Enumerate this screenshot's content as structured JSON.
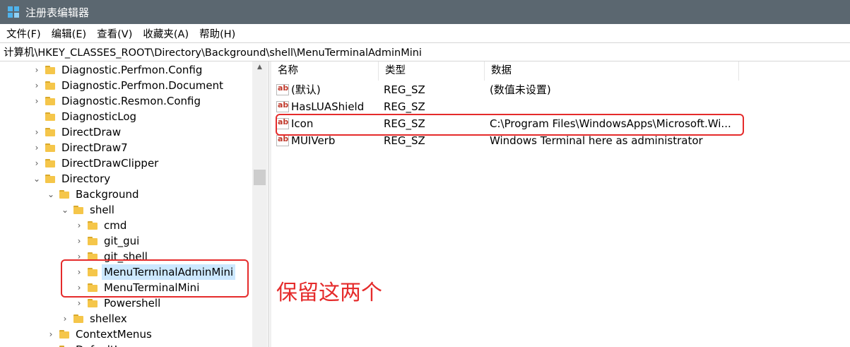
{
  "window": {
    "title": "注册表编辑器",
    "icon": "registry-icon"
  },
  "menubar": {
    "items": [
      "文件(F)",
      "编辑(E)",
      "查看(V)",
      "收藏夹(A)",
      "帮助(H)"
    ]
  },
  "address": {
    "path": "计算机\\HKEY_CLASSES_ROOT\\Directory\\Background\\shell\\MenuTerminalAdminMini"
  },
  "tree": {
    "items": [
      {
        "label": "Diagnostic.Perfmon.Config",
        "expander": "›"
      },
      {
        "label": "Diagnostic.Perfmon.Document",
        "expander": "›"
      },
      {
        "label": "Diagnostic.Resmon.Config",
        "expander": "›"
      },
      {
        "label": "DiagnosticLog",
        "expander": ""
      },
      {
        "label": "DirectDraw",
        "expander": "›"
      },
      {
        "label": "DirectDraw7",
        "expander": "›"
      },
      {
        "label": "DirectDrawClipper",
        "expander": "›"
      },
      {
        "label": "Directory",
        "expander": "⌄"
      },
      {
        "label": "Background",
        "expander": "⌄"
      },
      {
        "label": "shell",
        "expander": "⌄"
      },
      {
        "label": "cmd",
        "expander": "›"
      },
      {
        "label": "git_gui",
        "expander": "›"
      },
      {
        "label": "git_shell",
        "expander": "›"
      },
      {
        "label": "MenuTerminalAdminMini",
        "expander": "›",
        "selected": true
      },
      {
        "label": "MenuTerminalMini",
        "expander": "›"
      },
      {
        "label": "Powershell",
        "expander": "›"
      },
      {
        "label": "shellex",
        "expander": "›"
      },
      {
        "label": "ContextMenus",
        "expander": "›"
      },
      {
        "label": "DefaultIcon",
        "expander": ""
      }
    ]
  },
  "list": {
    "columns": [
      "名称",
      "类型",
      "数据"
    ],
    "rows": [
      {
        "name": "(默认)",
        "type": "REG_SZ",
        "data": "(数值未设置)"
      },
      {
        "name": "HasLUAShield",
        "type": "REG_SZ",
        "data": ""
      },
      {
        "name": "Icon",
        "type": "REG_SZ",
        "data": "C:\\Program Files\\WindowsApps\\Microsoft.Wi..."
      },
      {
        "name": "MUIVerb",
        "type": "REG_SZ",
        "data": "Windows Terminal here as administrator"
      }
    ]
  },
  "annotation": {
    "text": "保留这两个",
    "color": "#e52b2b"
  },
  "colors": {
    "titlebar": "#5b6770",
    "selection": "#cce8ff",
    "highlight": "#e52b2b"
  }
}
